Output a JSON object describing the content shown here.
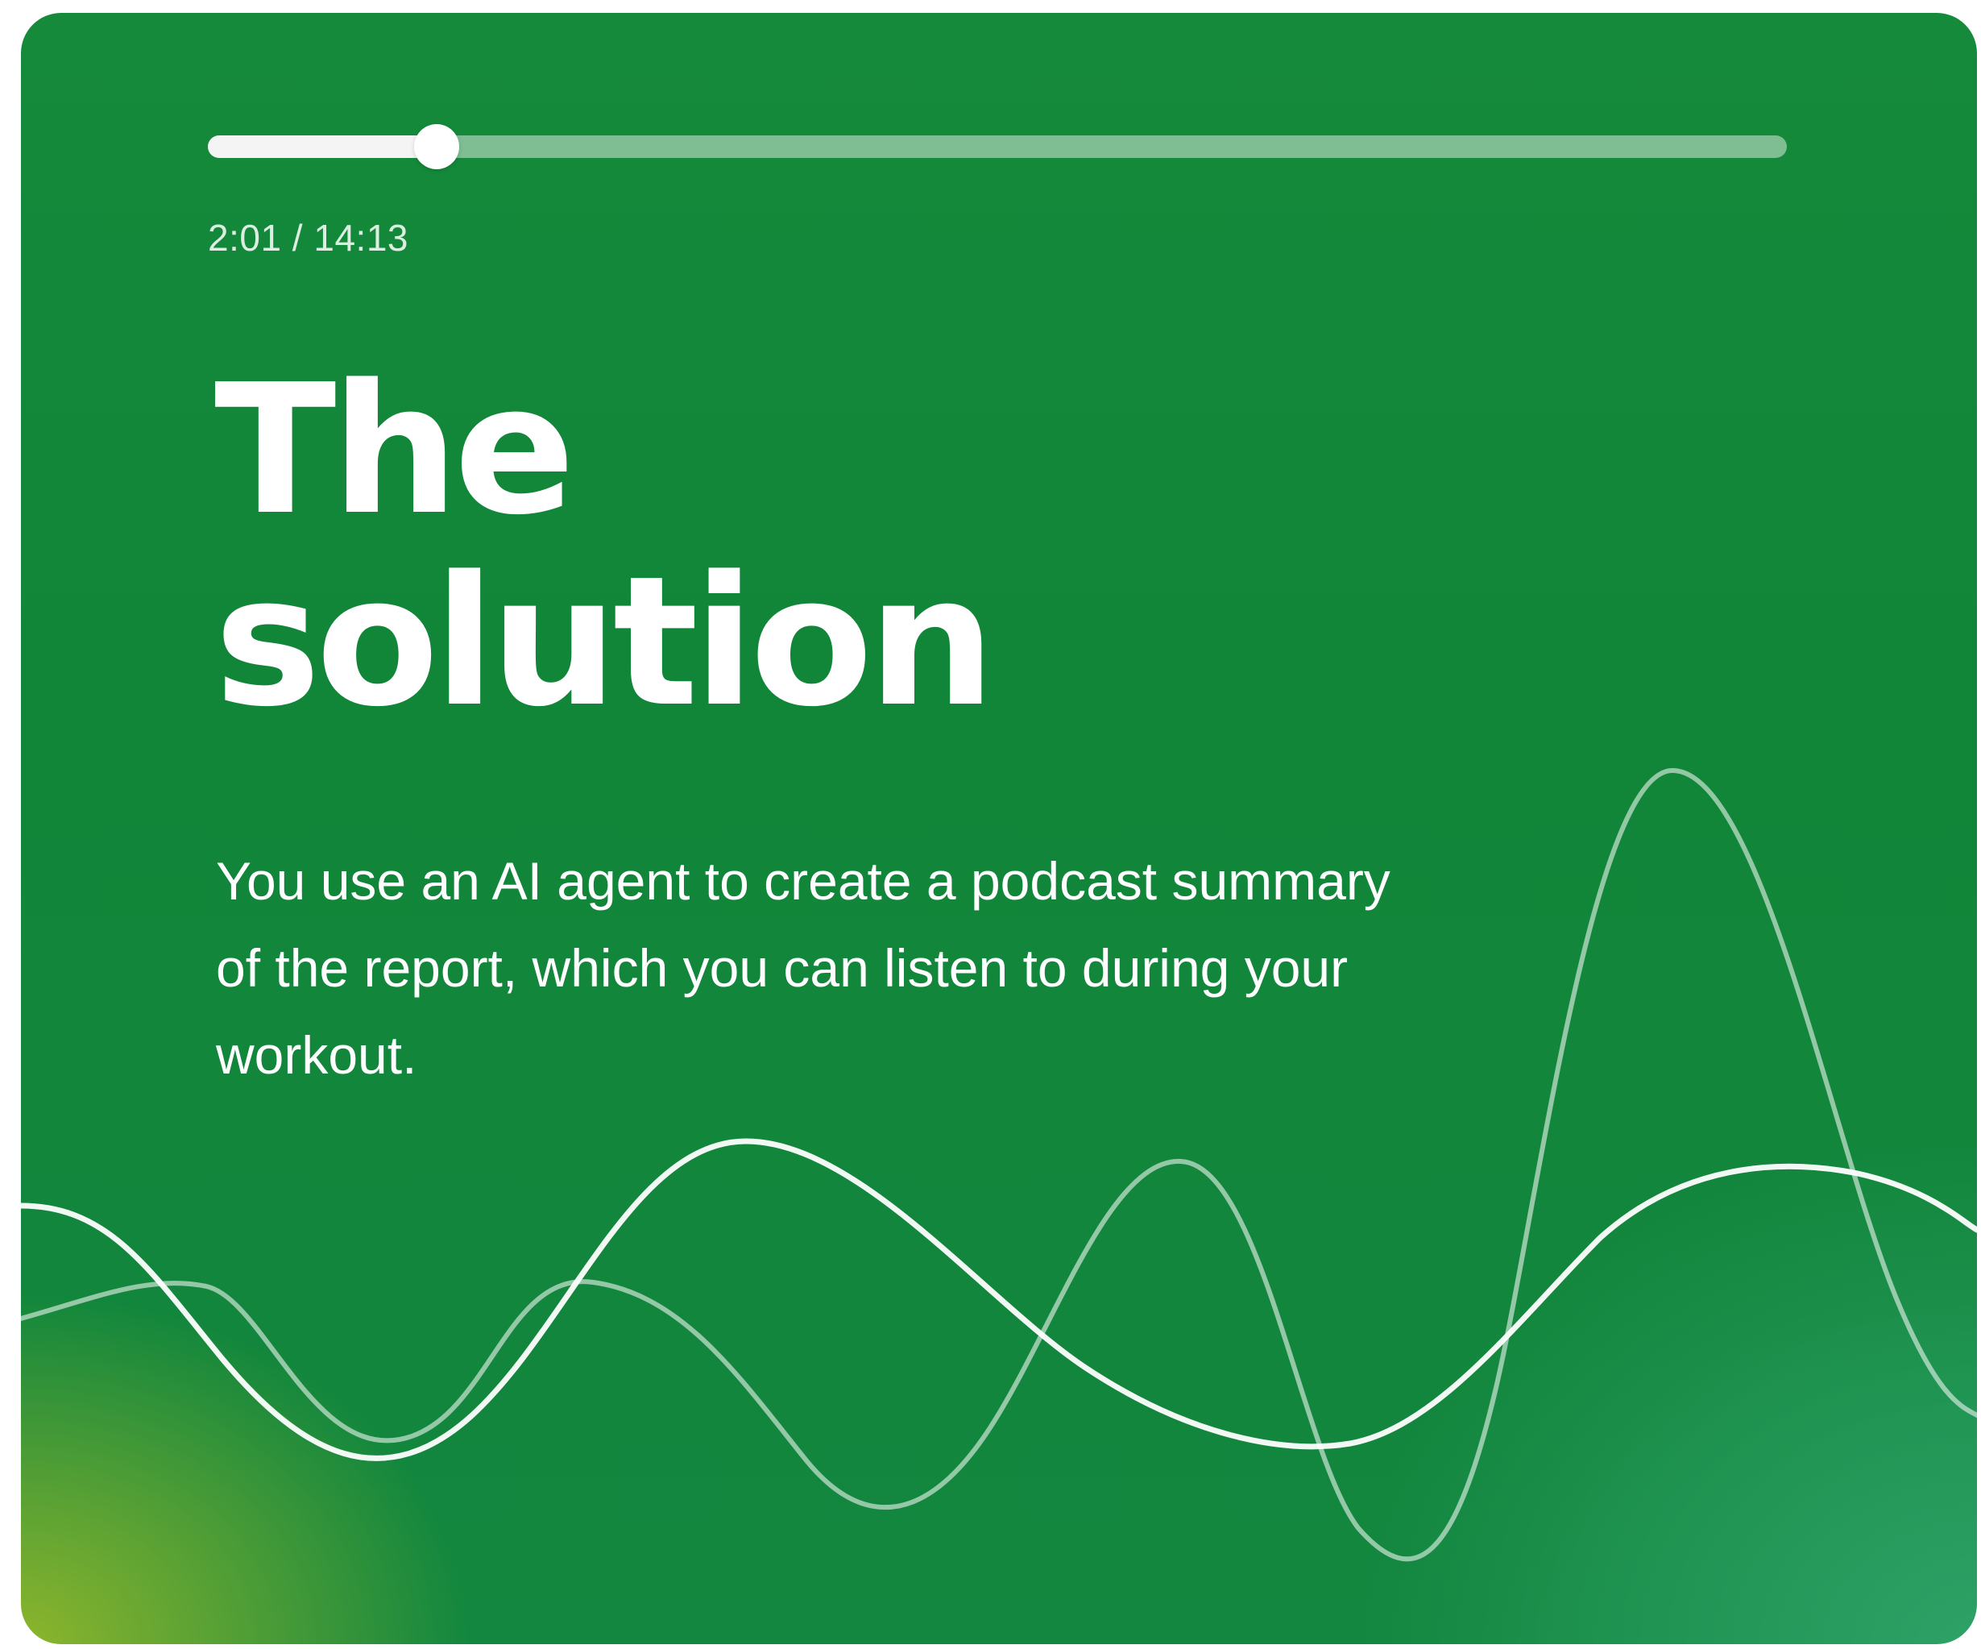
{
  "player": {
    "progress_fraction": 0.145,
    "time_label": "2:01 / 14:13"
  },
  "slide": {
    "title_line_1": "The",
    "title_line_2": "solution",
    "body": "You use an AI agent to create a podcast summary of the report, which you can listen to during your workout."
  },
  "decoration": {
    "wave_color": "#ffffff"
  }
}
